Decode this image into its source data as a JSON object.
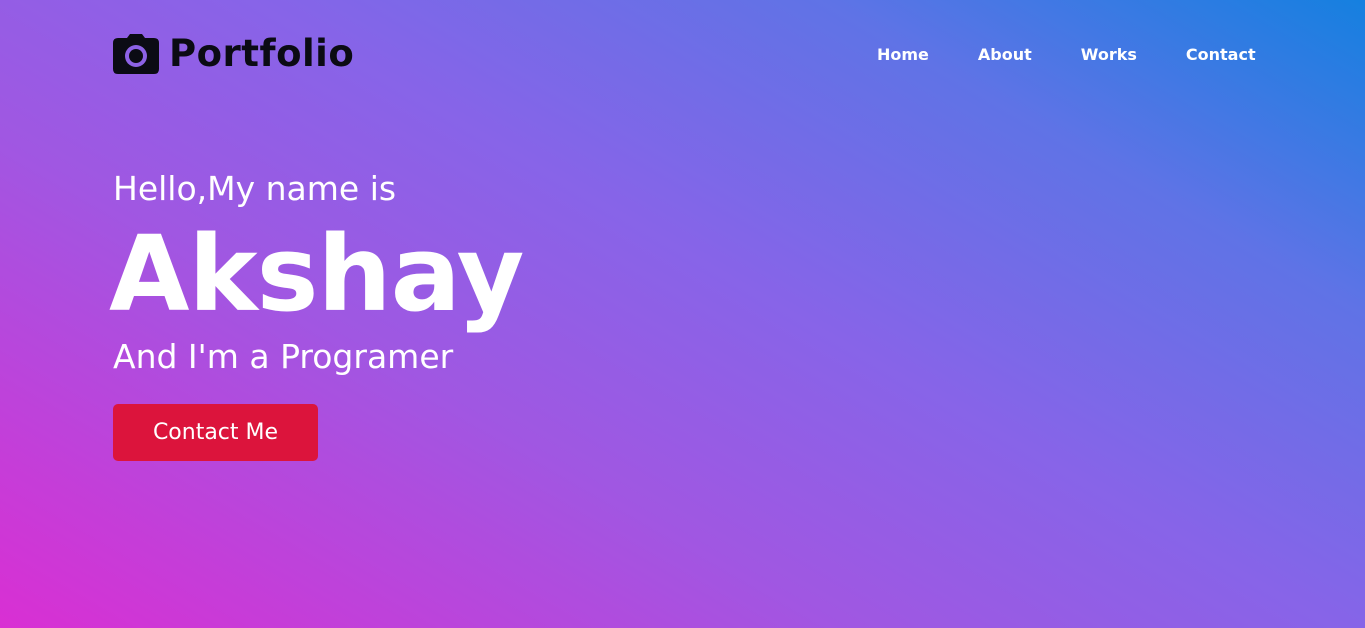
{
  "brand": {
    "logo_icon": "camera-icon",
    "name": "Portfolio"
  },
  "nav": {
    "items": [
      {
        "label": "Home"
      },
      {
        "label": "About"
      },
      {
        "label": "Works"
      },
      {
        "label": "Contact"
      }
    ]
  },
  "hero": {
    "greeting": "Hello,My name is",
    "name": "Akshay",
    "role": "And I'm a Programer",
    "cta_label": "Contact Me"
  },
  "colors": {
    "cta_background": "#dc143c",
    "text": "#ffffff",
    "logo_text": "#0b0b14",
    "gradient_start": "#d92fd3",
    "gradient_end": "#1580e0"
  }
}
